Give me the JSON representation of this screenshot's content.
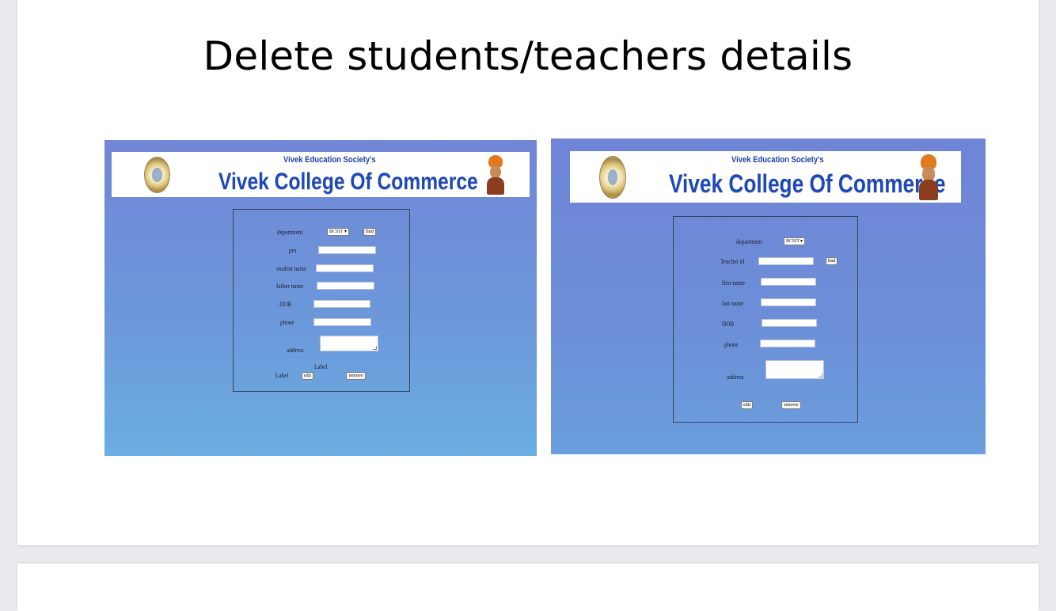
{
  "slide": {
    "title": "Delete students/teachers details"
  },
  "banner": {
    "society": "Vivek Education Society's",
    "college": "Vivek College Of Commerce"
  },
  "student_form": {
    "department_label": "department",
    "department_value": "BCSIT",
    "find_button": "find",
    "prn_label": "prn",
    "student_name_label": "student name",
    "father_name_label": "father name",
    "dob_label": "DOB",
    "phone_label": "phone",
    "address_label": "address",
    "label_top": "Label",
    "label_left": "Label",
    "edit_button": "edit",
    "remove_button": "remove"
  },
  "teacher_form": {
    "department_label": "department",
    "department_value": "BCSIT",
    "teacher_id_label": "Teacher id",
    "find_button": "find",
    "first_name_label": "first name",
    "last_name_label": "last name",
    "dob_label": "DOB",
    "phone_label": "phone",
    "address_label": "address",
    "edit_button": "edit",
    "remove_button": "remove"
  },
  "icons": {
    "seal": "college-seal-icon",
    "portrait": "vivekananda-portrait-icon"
  },
  "colors": {
    "screenshot_bg_top": "#7186d6",
    "screenshot_bg_bottom": "#6aaee2",
    "college_blue": "#1e49b8"
  }
}
